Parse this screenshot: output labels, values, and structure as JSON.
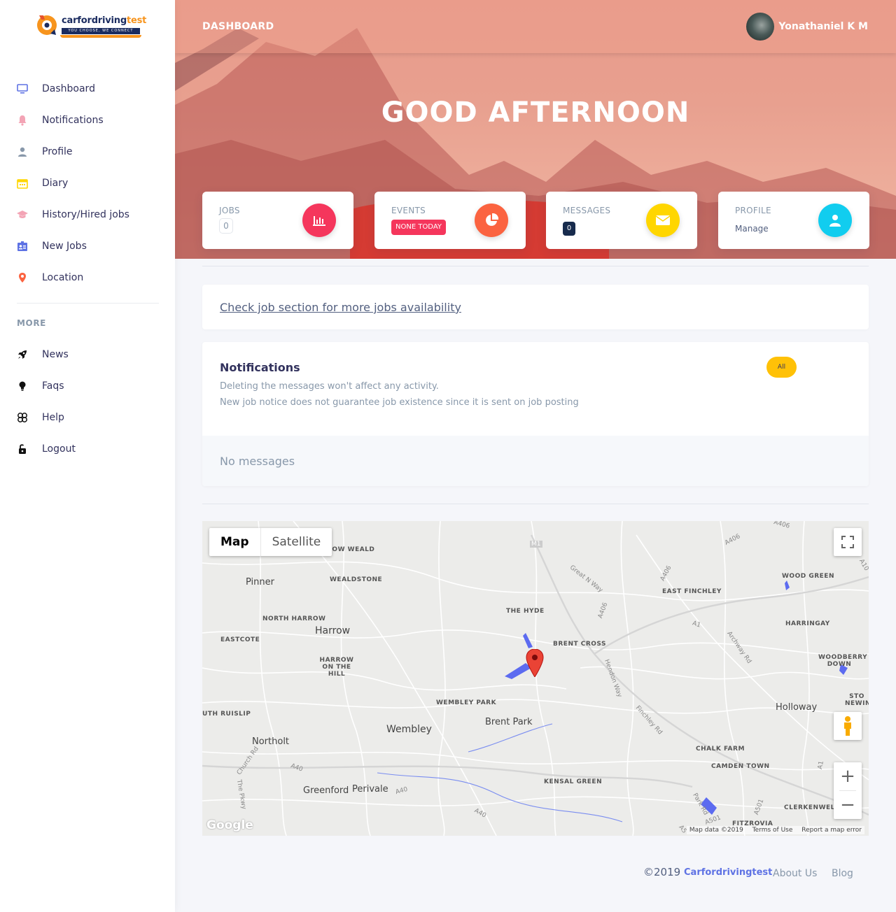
{
  "brand": {
    "name_part1": "carfordriving",
    "name_part2": "test",
    "tagline": "YOU CHOOSE, WE CONNECT"
  },
  "sidebar": {
    "items": [
      {
        "label": "Dashboard",
        "icon": "monitor-icon",
        "color": "#5e72e4"
      },
      {
        "label": "Notifications",
        "icon": "bell-icon",
        "color": "#f3a4b5"
      },
      {
        "label": "Profile",
        "icon": "user-icon",
        "color": "#8898aa"
      },
      {
        "label": "Diary",
        "icon": "calendar-icon",
        "color": "#ffd600"
      },
      {
        "label": "History/Hired jobs",
        "icon": "graduation-cap-icon",
        "color": "#f3a4b5"
      },
      {
        "label": "New Jobs",
        "icon": "id-card-icon",
        "color": "#5e72e4"
      },
      {
        "label": "Location",
        "icon": "pin-icon",
        "color": "#fb6340"
      }
    ],
    "more_heading": "MORE",
    "more_items": [
      {
        "label": "News",
        "icon": "rocket-icon"
      },
      {
        "label": "Faqs",
        "icon": "bulb-icon"
      },
      {
        "label": "Help",
        "icon": "support-icon"
      },
      {
        "label": "Logout",
        "icon": "lock-icon"
      }
    ]
  },
  "header": {
    "title": "DASHBOARD",
    "user_name": "Yonathaniel K M",
    "greeting": "GOOD AFTERNOON"
  },
  "cards": [
    {
      "label": "JOBS",
      "value": "0",
      "icon": "chart-bar-icon",
      "color": "#f5365c"
    },
    {
      "label": "EVENTS",
      "value": "NONE TODAY",
      "icon": "chart-pie-icon",
      "color": "#fb6340"
    },
    {
      "label": "MESSAGES",
      "value": "0",
      "icon": "envelope-icon",
      "color": "#ffd600"
    },
    {
      "label": "PROFILE",
      "value": "Manage",
      "icon": "user-icon",
      "color": "#11cdef"
    }
  ],
  "banner": {
    "link_text": "Check job section for more jobs availability"
  },
  "notifications": {
    "title": "Notifications",
    "filter_label": "All",
    "lines": [
      "Deleting the messages won't affect any activity.",
      "New job notice does not guarantee job existence since it is sent on job posting"
    ],
    "empty_text": "No messages"
  },
  "map": {
    "type_buttons": [
      "Map",
      "Satellite"
    ],
    "places": [
      "Pinner",
      "Harrow",
      "Wembley",
      "Brent Park",
      "Northolt",
      "Greenford",
      "Perivale",
      "Holloway"
    ],
    "districts": [
      "ROW WEALD",
      "WEALDSTONE",
      "NORTH HARROW",
      "EASTCOTE",
      "HARROW ON THE HILL",
      "THE HYDE",
      "BRENT CROSS",
      "WEMBLEY PARK",
      "UTH RUISLIP",
      "KENSAL GREEN",
      "EAST FINCHLEY",
      "WOOD GREEN",
      "HARRINGAY",
      "WOODBERRY DOWN",
      "STO NEWIN",
      "CHALK FARM",
      "CAMDEN TOWN",
      "CLERKENWELL",
      "FITZROVIA"
    ],
    "road_labels": [
      "M1",
      "A406",
      "Great N Way",
      "A406",
      "A1",
      "Archway Rd",
      "Hendon Way",
      "A406",
      "Finchley Rd",
      "Church Rd",
      "The Pkwy",
      "A40",
      "A40",
      "A40",
      "Park Rd",
      "A501",
      "A501",
      "A5",
      "A1",
      "A10",
      "A406"
    ],
    "logo": "Google",
    "attribution": [
      "Map data ©2019",
      "Terms of Use",
      "Report a map error"
    ],
    "zoom_in": "+",
    "zoom_out": "−"
  },
  "footer": {
    "copyright": "©2019",
    "brand_link": "Carfordrivingtest",
    "about": "About Us",
    "blog": "Blog"
  }
}
